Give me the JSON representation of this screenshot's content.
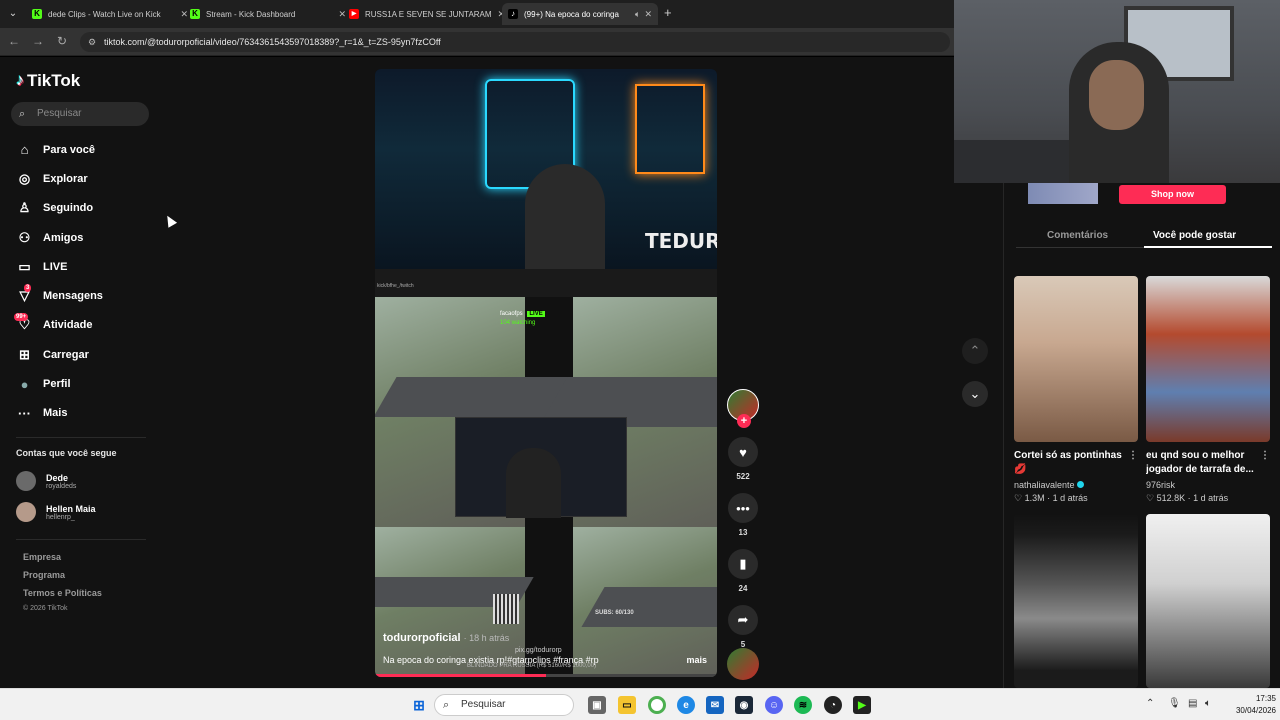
{
  "browser": {
    "tabs": [
      {
        "title": "dede Clips - Watch Live on Kick",
        "favicon_color": "#53fc18",
        "favicon_letter": "K"
      },
      {
        "title": "Stream - Kick Dashboard",
        "favicon_color": "#53fc18",
        "favicon_letter": "K"
      },
      {
        "title": "RUSS1A E SEVEN SE JUNTARAM",
        "favicon_color": "#ff0000",
        "favicon_letter": "▶"
      },
      {
        "title": "(99+) Na epoca do coringa",
        "favicon_color": "#ffffff",
        "favicon_letter": "♪",
        "active": true
      }
    ],
    "new_tab": "+",
    "url": "tiktok.com/@todurorpoficial/video/7634361543597018389?_r=1&_t=ZS-95yn7fzCOff"
  },
  "sidebar": {
    "brand": "TikTok",
    "search_placeholder": "Pesquisar",
    "nav": [
      {
        "label": "Para você",
        "icon": "home-icon",
        "glyph": "⌂"
      },
      {
        "label": "Explorar",
        "icon": "compass-icon",
        "glyph": "◎"
      },
      {
        "label": "Seguindo",
        "icon": "following-icon",
        "glyph": "♙"
      },
      {
        "label": "Amigos",
        "icon": "friends-icon",
        "glyph": "⚇"
      },
      {
        "label": "LIVE",
        "icon": "live-icon",
        "glyph": "▭"
      },
      {
        "label": "Mensagens",
        "icon": "messages-icon",
        "glyph": "▽",
        "badge": "3"
      },
      {
        "label": "Atividade",
        "icon": "activity-icon",
        "glyph": "♡",
        "badge": "99+"
      },
      {
        "label": "Carregar",
        "icon": "upload-icon",
        "glyph": "⊞"
      },
      {
        "label": "Perfil",
        "icon": "profile-icon",
        "glyph": "●"
      },
      {
        "label": "Mais",
        "icon": "more-icon",
        "glyph": "···"
      }
    ],
    "following_title": "Contas que você segue",
    "following": [
      {
        "name": "Dede",
        "handle": "royaldeds"
      },
      {
        "name": "Hellen Maia",
        "handle": "hellenrp_"
      }
    ],
    "footer": {
      "empresa": "Empresa",
      "programa": "Programa",
      "termos": "Termos e Políticas",
      "copyright": "© 2026 TikTok"
    }
  },
  "video": {
    "author": "todurorpoficial",
    "time_ago": "· 18 h atrás",
    "caption": "Na epoca do coringa existia rp!#gtarpclips #frança #rp",
    "more": "mais",
    "stream_url": "kick/bfhe_/twitch",
    "live_user": "facaofps",
    "live_label": "LIVE",
    "watching": "104 watching",
    "subs": "SUBS: 60/130",
    "progress": 0.5,
    "overlay_tag": "TEDURP",
    "overlay_footer": "pix.gg/todurorp",
    "overlay_footer2": "BLINDADO PRA RUSSIA (R$ 5160/R$ 1000,00)"
  },
  "actions": {
    "likes": "522",
    "comments": "13",
    "saves": "24",
    "shares": "5"
  },
  "right_panel": {
    "shop_button": "Shop now",
    "tabs": [
      "Comentários",
      "Você pode gostar"
    ],
    "active_tab": 1,
    "cards": [
      {
        "title": "Cortei só as pontinhas 💋",
        "author": "nathaliavalente",
        "verified": true,
        "likes": "1.3M",
        "age": "1 d atrás",
        "colors": [
          "#d9c9b8",
          "#7a5a45"
        ]
      },
      {
        "title": "eu qnd sou o melhor jogador de tarrafa de...",
        "author": "976risk",
        "verified": false,
        "likes": "512.8K",
        "age": "1 d atrás",
        "colors": [
          "#b44a2e",
          "#5f7fb0"
        ]
      },
      {
        "title": "",
        "author": "",
        "verified": false,
        "likes": "",
        "age": "",
        "colors": [
          "#1b1b1b",
          "#8a8a8a"
        ]
      },
      {
        "title": "",
        "author": "",
        "verified": false,
        "likes": "",
        "age": "",
        "colors": [
          "#f0f0f0",
          "#3a3a3a"
        ]
      }
    ]
  },
  "taskbar": {
    "search_placeholder": "Pesquisar",
    "time": "17:35",
    "date": "30/04/2026"
  }
}
